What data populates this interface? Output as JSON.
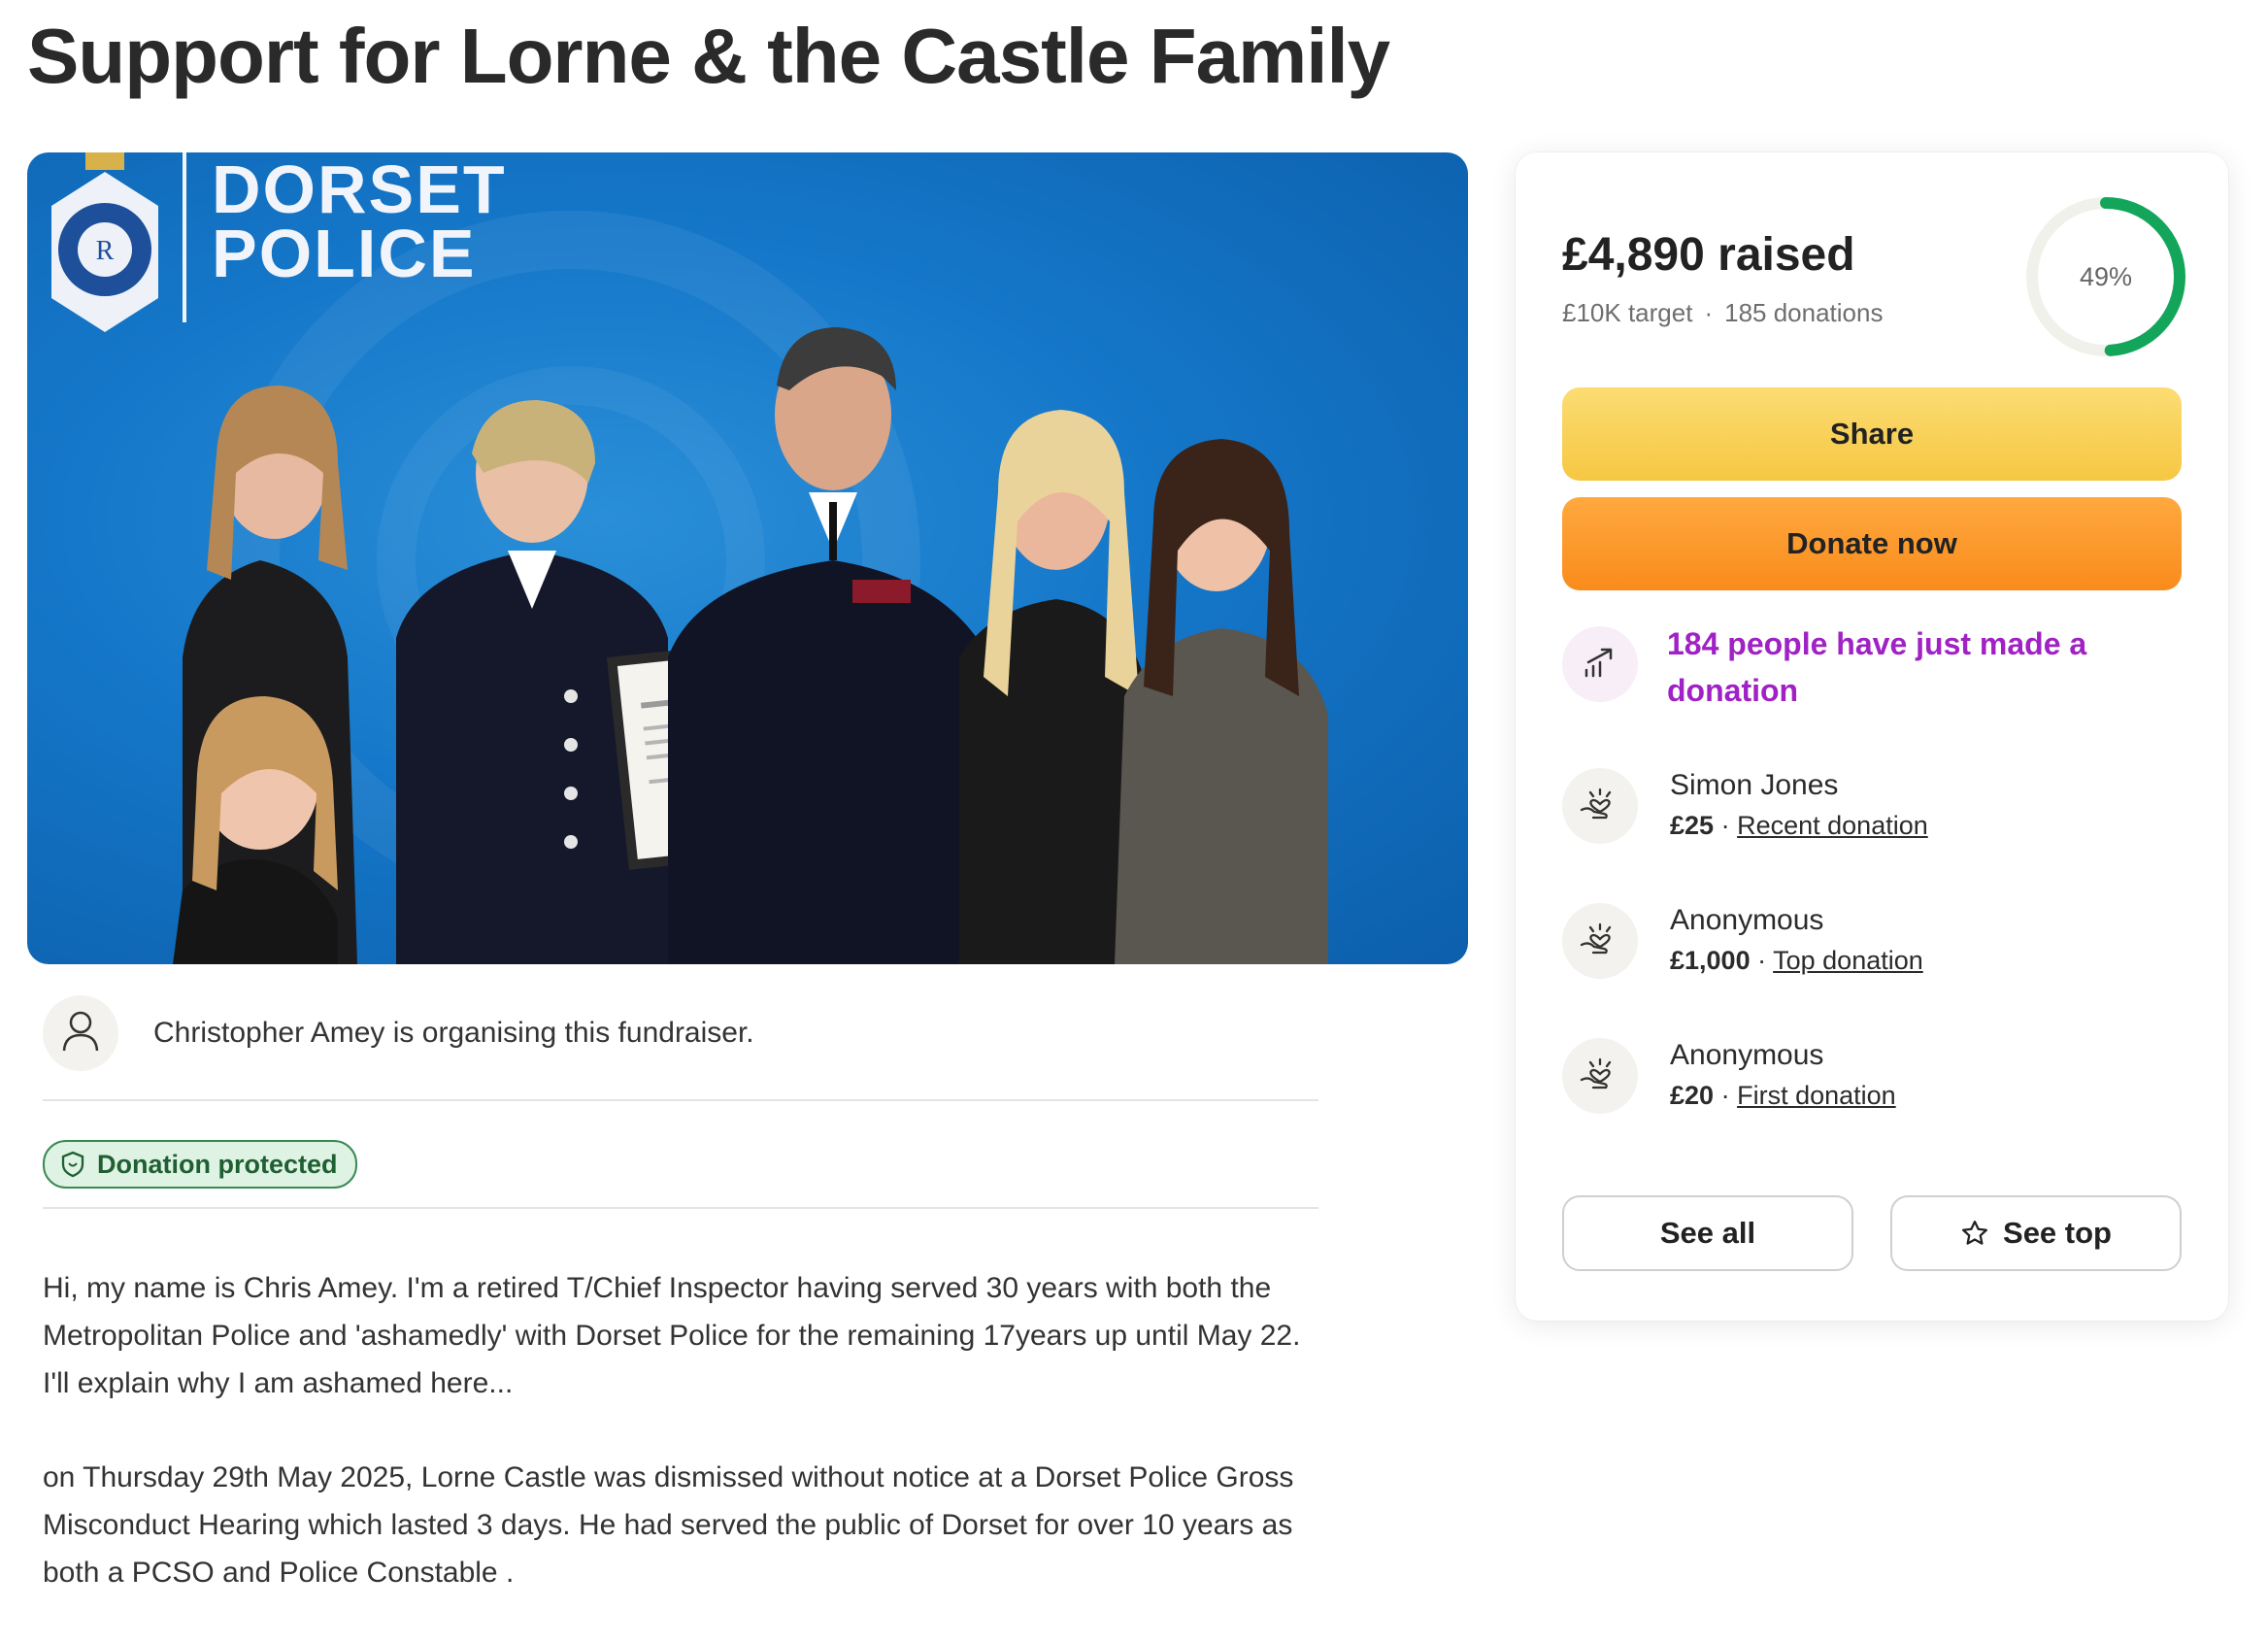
{
  "page": {
    "title": "Support for Lorne & the Castle Family"
  },
  "hero": {
    "brand_line1": "DORSET",
    "brand_line2": "POLICE"
  },
  "organiser": {
    "text": "Christopher Amey is organising this fundraiser."
  },
  "badge": {
    "label": "Donation protected"
  },
  "story": {
    "paragraphs": [
      "Hi, my name is Chris Amey. I'm a retired T/Chief Inspector having served 30 years with both the Metropolitan Police and 'ashamedly' with Dorset Police for the remaining 17years up until May 22. I'll explain why I am ashamed here...",
      "on Thursday 29th May 2025, Lorne Castle was dismissed without notice at a Dorset Police Gross Misconduct Hearing which lasted 3 days. He had served the public of Dorset for over 10 years as both a PCSO and Police Constable ."
    ]
  },
  "card": {
    "raised": "£4,890 raised",
    "target": "£10K target",
    "separator": "·",
    "donations": "185 donations",
    "progress_label": "49%",
    "progress_fraction": 0.49,
    "progress_color": "#13a65a",
    "share_label": "Share",
    "donate_label": "Donate now",
    "trend_text": "184 people have just made a donation",
    "donors": [
      {
        "name": "Simon Jones",
        "amount": "£25",
        "sep": "·",
        "tag": "Recent donation"
      },
      {
        "name": "Anonymous",
        "amount": "£1,000",
        "sep": "·",
        "tag": "Top donation"
      },
      {
        "name": "Anonymous",
        "amount": "£20",
        "sep": "·",
        "tag": "First donation"
      }
    ],
    "see_all_label": "See all",
    "see_top_label": "See top"
  },
  "icons": {
    "user": "user-icon",
    "shield": "shield-icon",
    "trend": "trending-up-icon",
    "donor": "heart-hand-icon",
    "star": "star-icon"
  }
}
